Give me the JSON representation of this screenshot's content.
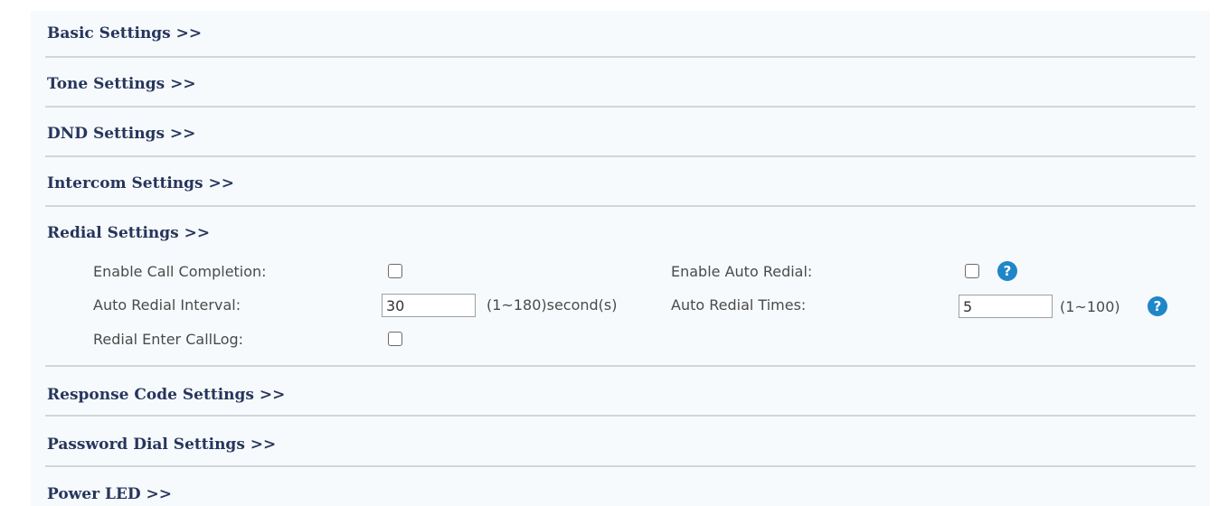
{
  "sections": {
    "basic": "Basic Settings >>",
    "tone": "Tone Settings >>",
    "dnd": "DND Settings >>",
    "intercom": "Intercom Settings >>",
    "redial": "Redial Settings >>",
    "response_code": "Response Code Settings >>",
    "password_dial": "Password Dial Settings >>",
    "power_led": "Power LED >>"
  },
  "redial": {
    "enable_call_completion": {
      "label": "Enable Call Completion:",
      "checked": false
    },
    "enable_auto_redial": {
      "label": "Enable Auto Redial:",
      "checked": false
    },
    "auto_redial_interval": {
      "label": "Auto Redial Interval:",
      "value": "30",
      "hint": "(1~180)second(s)"
    },
    "auto_redial_times": {
      "label": "Auto Redial Times:",
      "value": "5",
      "hint": "(1~100)"
    },
    "redial_enter_calllog": {
      "label": "Redial Enter CallLog:",
      "checked": false
    }
  },
  "colors": {
    "header_text": "#26355c",
    "help_icon": "#1f86c8",
    "panel_background": "#f7fafc"
  },
  "icons": {
    "help": "question-circle-icon"
  }
}
